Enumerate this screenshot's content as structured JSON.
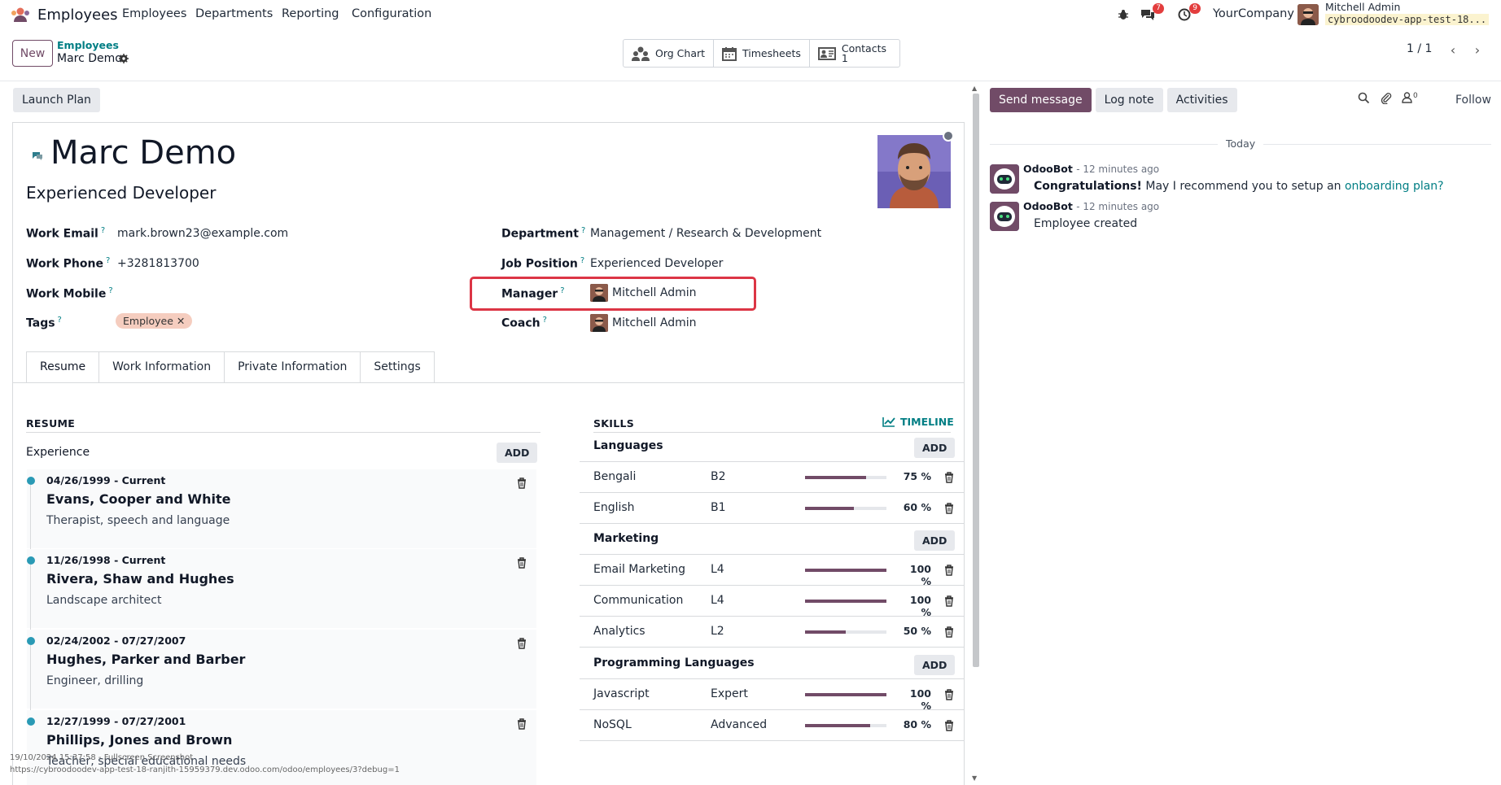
{
  "topnav": {
    "app_name": "Employees",
    "menu": [
      "Employees",
      "Departments",
      "Reporting",
      "Configuration"
    ],
    "chat_badge": "7",
    "activity_badge": "9",
    "company": "YourCompany",
    "user_name": "Mitchell Admin",
    "db_name": "cybroodoodev-app-test-18..."
  },
  "control": {
    "new_label": "New",
    "breadcrumb_parent": "Employees",
    "breadcrumb_current": "Marc Demo",
    "smart_buttons": {
      "org_chart": "Org Chart",
      "timesheets": "Timesheets",
      "contacts": "Contacts",
      "contacts_count": "1"
    },
    "pager": "1 / 1"
  },
  "status": {
    "launch_plan": "Launch Plan"
  },
  "employee": {
    "name": "Marc Demo",
    "job_title": "Experienced Developer",
    "fields": {
      "work_email_label": "Work Email",
      "work_email": "mark.brown23@example.com",
      "work_phone_label": "Work Phone",
      "work_phone": "+3281813700",
      "work_mobile_label": "Work Mobile",
      "tags_label": "Tags",
      "tag": "Employee",
      "department_label": "Department",
      "department": "Management / Research & Development",
      "job_position_label": "Job Position",
      "job_position": "Experienced Developer",
      "manager_label": "Manager",
      "manager": "Mitchell Admin",
      "coach_label": "Coach",
      "coach": "Mitchell Admin",
      "help_mark": "?"
    }
  },
  "tabs": [
    "Resume",
    "Work Information",
    "Private Information",
    "Settings"
  ],
  "resume": {
    "title": "RESUME",
    "experience_label": "Experience",
    "add_label": "ADD",
    "items": [
      {
        "date": "04/26/1999 - Current",
        "company": "Evans, Cooper and White",
        "desc": "Therapist, speech and language"
      },
      {
        "date": "11/26/1998 - Current",
        "company": "Rivera, Shaw and Hughes",
        "desc": "Landscape architect"
      },
      {
        "date": "02/24/2002 - 07/27/2007",
        "company": "Hughes, Parker and Barber",
        "desc": "Engineer, drilling"
      },
      {
        "date": "12/27/1999 - 07/27/2001",
        "company": "Phillips, Jones and Brown",
        "desc": "Teacher, special educational needs"
      }
    ]
  },
  "skills": {
    "title": "SKILLS",
    "timeline_label": "TIMELINE",
    "add_label": "ADD",
    "groups": [
      {
        "name": "Languages",
        "rows": [
          {
            "name": "Bengali",
            "level": "B2",
            "pct": 75,
            "pct_label": "75 %"
          },
          {
            "name": "English",
            "level": "B1",
            "pct": 60,
            "pct_label": "60 %"
          }
        ]
      },
      {
        "name": "Marketing",
        "rows": [
          {
            "name": "Email Marketing",
            "level": "L4",
            "pct": 100,
            "pct_label": "100 %"
          },
          {
            "name": "Communication",
            "level": "L4",
            "pct": 100,
            "pct_label": "100 %"
          },
          {
            "name": "Analytics",
            "level": "L2",
            "pct": 50,
            "pct_label": "50 %"
          }
        ]
      },
      {
        "name": "Programming Languages",
        "rows": [
          {
            "name": "Javascript",
            "level": "Expert",
            "pct": 100,
            "pct_label": "100 %"
          },
          {
            "name": "NoSQL",
            "level": "Advanced",
            "pct": 80,
            "pct_label": "80 %"
          }
        ]
      }
    ]
  },
  "chatter": {
    "send_message": "Send message",
    "log_note": "Log note",
    "activities": "Activities",
    "followers_count": "0",
    "follow": "Follow",
    "today": "Today",
    "messages": [
      {
        "author": "OdooBot",
        "time": "- 12 minutes ago",
        "bold": "Congratulations!",
        "text": " May I recommend you to setup an ",
        "link": "onboarding plan?"
      },
      {
        "author": "OdooBot",
        "time": "- 12 minutes ago",
        "text": "Employee created"
      }
    ]
  },
  "footer": {
    "timestamp": "19/10/2024 15:37:58 - Fullscreen Screenshot",
    "url": "https://cybroodoodev-app-test-18-ranjith-15959379.dev.odoo.com/odoo/employees/3?debug=1"
  },
  "colors": {
    "brand": "#714b67",
    "link": "#017e84",
    "highlight": "#dc3545"
  }
}
